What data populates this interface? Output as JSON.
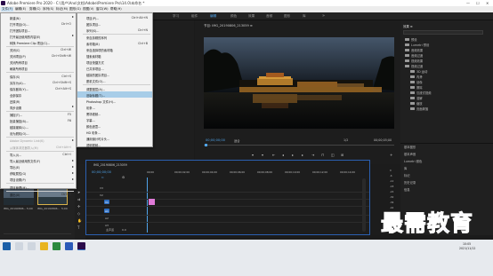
{
  "window": {
    "title": "Adobe Premiere Pro 2020 - C:\\用户\\Ano\\文档\\Adobe\\Premiere Pro\\14.0\\未命名 *",
    "controls": [
      "—",
      "☐",
      "✕"
    ]
  },
  "menubar": [
    "文件(F)",
    "编辑(E)",
    "剪辑(C)",
    "序列(S)",
    "标记(M)",
    "图形(G)",
    "视图(V)",
    "窗口(W)",
    "帮助(H)"
  ],
  "workspaces": [
    "学习",
    "组件",
    "编辑",
    "颜色",
    "效果",
    "音频",
    "图形",
    "库"
  ],
  "workspace_active": "编辑",
  "file_menu": {
    "items": [
      {
        "label": "新建(N)",
        "shortcut": "",
        "submenu": true,
        "highlight": false,
        "disabled": false
      },
      {
        "label": "打开项目(O)...",
        "shortcut": "Ctrl+O"
      },
      {
        "label": "打开团队项目...",
        "shortcut": ""
      },
      {
        "label": "打开最近使用的内容(E)",
        "shortcut": "",
        "submenu": true
      },
      {
        "label": "转换 Premiere Clip 项目(C)...",
        "shortcut": ""
      },
      {
        "label": "关闭(C)",
        "shortcut": "Ctrl+W"
      },
      {
        "label": "关闭项目(P)",
        "shortcut": "Ctrl+Shift+W"
      },
      {
        "label": "关闭所有项目",
        "shortcut": ""
      },
      {
        "label": "刷新所有项目",
        "shortcut": ""
      },
      {
        "label": "保存(S)",
        "shortcut": "Ctrl+S"
      },
      {
        "label": "另存为(A)...",
        "shortcut": "Ctrl+Shift+S"
      },
      {
        "label": "保存副本(Y)...",
        "shortcut": "Ctrl+Alt+S"
      },
      {
        "label": "全部保存",
        "shortcut": ""
      },
      {
        "label": "还原(R)",
        "shortcut": ""
      },
      {
        "label": "同步设置",
        "shortcut": "",
        "submenu": true
      },
      {
        "label": "捕捉(T)...",
        "shortcut": "F5"
      },
      {
        "label": "批量捕捉(B)...",
        "shortcut": "F6"
      },
      {
        "label": "链接媒体(L)...",
        "shortcut": ""
      },
      {
        "label": "设为脱机(O)...",
        "shortcut": ""
      },
      {
        "label": "Adobe Dynamic Link(K)",
        "shortcut": "",
        "submenu": true,
        "disabled": true
      },
      {
        "label": "从媒体浏览器导入(M)",
        "shortcut": "Ctrl+Alt+I",
        "disabled": true
      },
      {
        "label": "导入(I)...",
        "shortcut": "Ctrl+I"
      },
      {
        "label": "导入最近使用的文件(F)",
        "shortcut": "",
        "submenu": true
      },
      {
        "label": "导出(E)",
        "shortcut": "",
        "submenu": true
      },
      {
        "label": "获取属性(G)",
        "shortcut": "",
        "submenu": true
      },
      {
        "label": "项目设置(P)",
        "shortcut": "",
        "submenu": true
      },
      {
        "label": "项目管理(M)...",
        "shortcut": ""
      },
      {
        "label": "退出(X)",
        "shortcut": "Ctrl+Q"
      }
    ]
  },
  "new_submenu": {
    "items": [
      {
        "label": "项目(P)...",
        "shortcut": "Ctrl+Alt+N"
      },
      {
        "label": "团队项目...",
        "shortcut": ""
      },
      {
        "label": "序列(S)...",
        "shortcut": "Ctrl+N"
      },
      {
        "label": "来自剪辑的序列",
        "shortcut": ""
      },
      {
        "label": "素材箱(B)",
        "shortcut": "Ctrl+B"
      },
      {
        "label": "来自选择项的素材箱",
        "shortcut": ""
      },
      {
        "label": "搜索素材箱",
        "shortcut": ""
      },
      {
        "label": "项目快捷方式",
        "shortcut": ""
      },
      {
        "label": "已共享项目...",
        "shortcut": ""
      },
      {
        "label": "链接的团队项目...",
        "shortcut": ""
      },
      {
        "label": "脱机文件(O)...",
        "shortcut": ""
      },
      {
        "label": "调整图层(A)...",
        "shortcut": ""
      },
      {
        "label": "旧版标题(T)...",
        "shortcut": "",
        "highlight": true
      },
      {
        "label": "Photoshop 文件(H)...",
        "shortcut": ""
      },
      {
        "label": "彩条...",
        "shortcut": ""
      },
      {
        "label": "黑场视频...",
        "shortcut": ""
      },
      {
        "label": "字幕...",
        "shortcut": ""
      },
      {
        "label": "颜色遮罩...",
        "shortcut": ""
      },
      {
        "label": "HD 彩条...",
        "shortcut": ""
      },
      {
        "label": "通用倒计时片头...",
        "shortcut": ""
      },
      {
        "label": "透明视频...",
        "shortcut": ""
      }
    ]
  },
  "program_monitor": {
    "title": "节目: IMG_20190806_213059 ≡",
    "timecode_left": "00;00;00;00",
    "fit_label": "适合",
    "quality": "1/2",
    "timecode_right": "00;00;05;00"
  },
  "project_panel": {
    "clips": [
      {
        "name": "IMG_20190806...",
        "duration": "5;00"
      },
      {
        "name": "IMG_20190806...",
        "duration": "5;00"
      }
    ]
  },
  "timeline": {
    "tab": "IMG_20190806_213059",
    "timecode": "00;00;00;00",
    "ruler": [
      "00;00",
      "00;00;02;00",
      "00;00;04;00",
      "00;00;06;00",
      "00;00;08;00",
      "00;00;10;00",
      "00;00;12;00",
      "00;00;14;00",
      "00;00;16;00"
    ],
    "tracks": [
      "V3",
      "V2",
      "V1",
      "A1",
      "A2",
      "A3"
    ],
    "master_label": "主声道",
    "master_value": "0.0"
  },
  "meter_scale": [
    "0",
    "-6",
    "-12",
    "-18",
    "-24",
    "-30",
    "-36",
    "-42",
    "-48",
    "-54",
    "dB"
  ],
  "effects_panel": {
    "header": "效果 ≡",
    "tree": [
      "预设",
      "Lumetri 预设",
      "音频效果",
      "音频过渡",
      "视频效果",
      "视频过渡",
      "3D 运动",
      "内滑",
      "划像",
      "擦除",
      "沉浸式视频",
      "溶解",
      "缩放",
      "页面剥落"
    ],
    "sections": [
      "基本图形",
      "基本声音",
      "Lumetri 颜色",
      "库",
      "标记",
      "历史记录",
      "信息"
    ]
  },
  "taskbar": {
    "time": "10:05",
    "date": "2021/11/12"
  },
  "watermark": "最需教育",
  "colors": {
    "accent_blue": "#2d6ec2",
    "timecode_blue": "#4fa3e8",
    "menu_highlight": "#a8cde8",
    "clip_pink": "#e07ad8"
  }
}
